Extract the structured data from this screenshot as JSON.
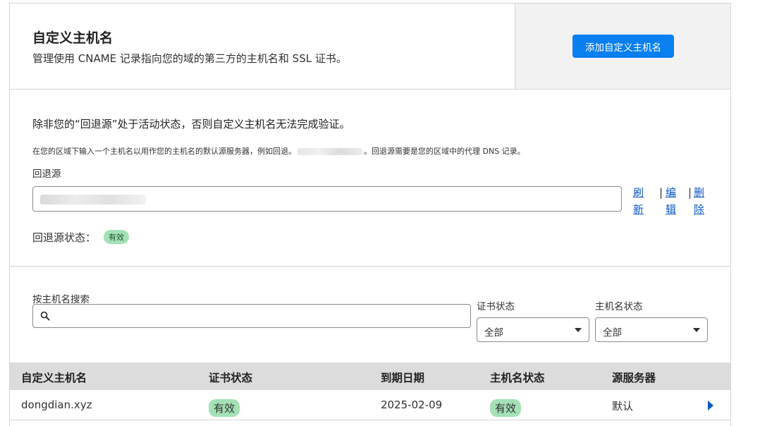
{
  "header": {
    "title": "自定义主机名",
    "description": "管理使用 CNAME 记录指向您的域的第三方的主机名和 SSL 证书。",
    "add_button": "添加自定义主机名"
  },
  "fallback": {
    "warning": "除非您的“回退源”处于活动状态，否则自定义主机名无法完成验证。",
    "hint_prefix": "在您的区域下输入一个主机名以用作您的主机名的默认源服务器，例如回退。",
    "hint_suffix": "。回退源需要是您的区域中的代理 DNS 记录。",
    "label": "回退源",
    "actions": {
      "refresh": "刷新",
      "edit": "编辑",
      "delete": "删除",
      "separator": "|"
    },
    "status_label": "回退源状态：",
    "status_value": "有效"
  },
  "filters": {
    "search_label": "按主机名搜索",
    "search_placeholder": "",
    "cert_status_label": "证书状态",
    "cert_status_value": "全部",
    "hostname_status_label": "主机名状态",
    "hostname_status_value": "全部"
  },
  "table": {
    "columns": [
      "自定义主机名",
      "证书状态",
      "到期日期",
      "主机名状态",
      "源服务器"
    ],
    "rows": [
      {
        "hostname": "dongdian.xyz",
        "cert_status": "有效",
        "expiry": "2025-02-09",
        "hostname_status": "有效",
        "origin": "默认"
      }
    ]
  },
  "colors": {
    "primary": "#0a7ff0",
    "link": "#0a58ca",
    "badge_green": "#a4e1b7"
  }
}
